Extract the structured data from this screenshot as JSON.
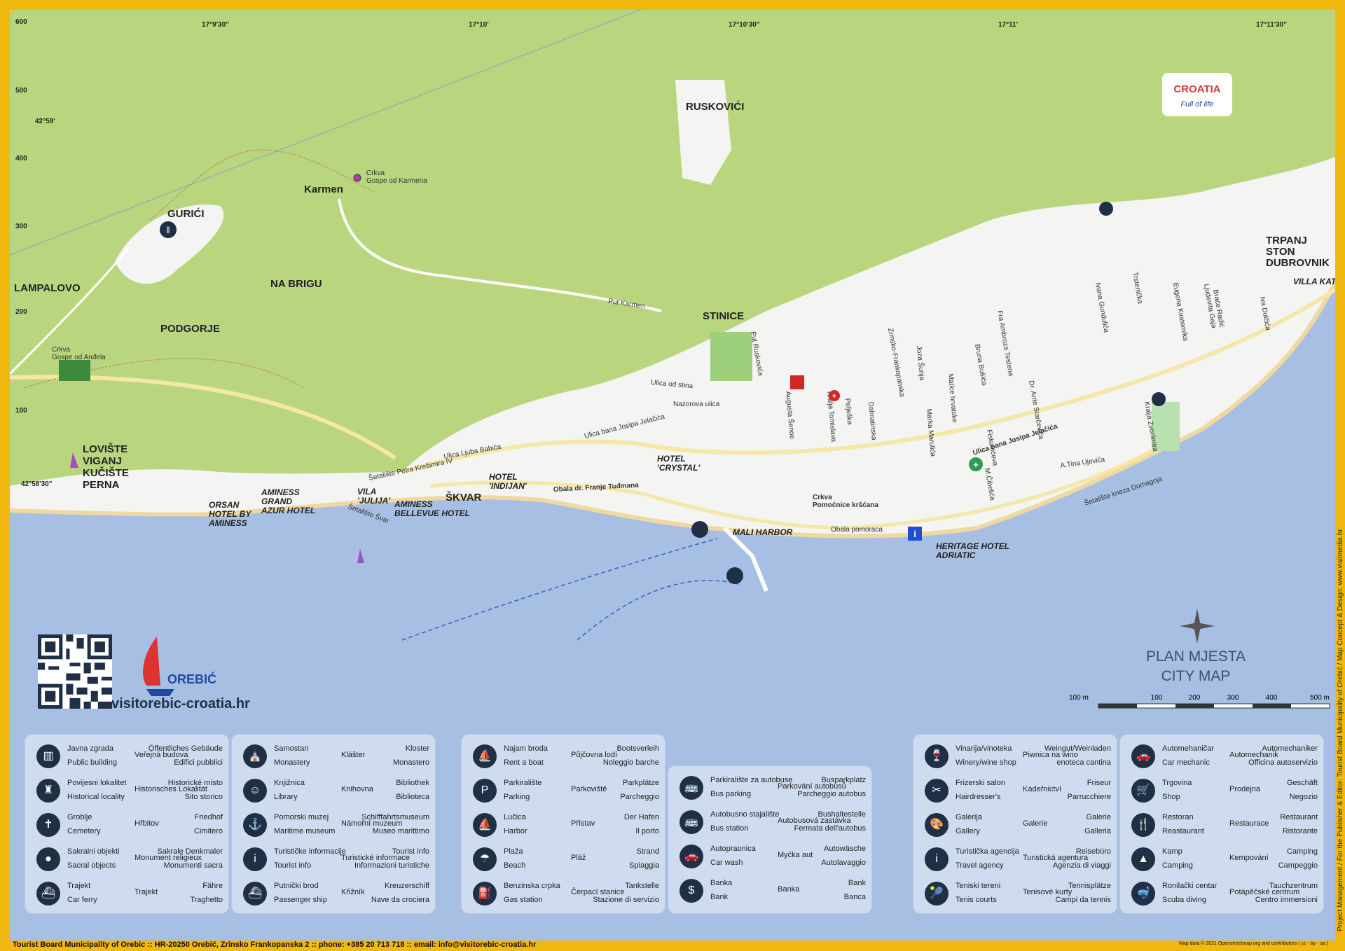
{
  "coords": {
    "elevation": [
      "600",
      "500",
      "400",
      "300",
      "200",
      "100"
    ],
    "lon": [
      "17°9'30\"",
      "17°10'",
      "17°10'30\"",
      "17°11'",
      "17°11'30\""
    ],
    "lat": [
      "42°59'",
      "42°58'30\""
    ]
  },
  "places": {
    "lampalovo": "LAMPALOVO",
    "gurici": "GURIĆI",
    "karmen": "Karmen",
    "na_brigu": "NA BRIGU",
    "podgorje": "PODGORJE",
    "ruskovici": "RUSKOVIĆI",
    "stinice": "STINICE",
    "skvar": "ŠKVAR",
    "villa_katarina": "VILLA KATARINA",
    "trpanj": "TRPANJ",
    "ston": "STON",
    "dubrovnik": "DUBROVNIK",
    "loviste": "LOVIŠTE",
    "viganj": "VIGANJ",
    "kuciste": "KUČIŠTE",
    "perna": "PERNA"
  },
  "pois": {
    "crkva_karmen_1": "Crkva",
    "crkva_karmen_2": "Gospe od Karmena",
    "crkva_andela_1": "Crkva",
    "crkva_andela_2": "Gospe od Anđela",
    "crkva_pomocnice_1": "Crkva",
    "crkva_pomocnice_2": "Pomoćnice kršćana",
    "mali_harbor": "MALI HARBOR"
  },
  "hotels": {
    "orsan_1": "ORSAN",
    "orsan_2": "HOTEL BY",
    "orsan_3": "AMINESS",
    "grand_1": "AMINESS",
    "grand_2": "GRAND",
    "grand_3": "AZUR HOTEL",
    "julija_1": "VILA",
    "julija_2": "'JULIJA'",
    "bellevue_1": "AMINESS",
    "bellevue_2": "BELLEVUE HOTEL",
    "indijan_1": "HOTEL",
    "indijan_2": "'INDIJAN'",
    "crystal_1": "HOTEL",
    "crystal_2": "'CRYSTAL'",
    "adriatic_1": "HERITAGE HOTEL",
    "adriatic_2": "ADRIATIC"
  },
  "streets": {
    "s1": "Put Karmen",
    "s2": "Ulica od stina",
    "s3": "Nazorova ulica",
    "s4": "Ulica bana Josipa Jelačića",
    "s5": "Ulica Ljuba Babića",
    "s6": "Šetalište Petra Krešimira IV",
    "s7": "Obala dr. Franje Tuđmana",
    "s8": "Šetalište Švar",
    "s9": "Ulica bana Josipa Jelačića",
    "s10": "Šetalište kneza Domagoja",
    "s11": "A.Tina Ujevića",
    "s12": "Put Ruskovića",
    "s13": "Augusta Šenoe",
    "s14": "Kralja Tomislava",
    "s15": "Pelješka",
    "s16": "Dalmatinska",
    "s17": "Zrinsko-Frankopanska",
    "s18": "Joza Šunja",
    "s19": "Marka Marulića",
    "s20": "Matice hrvatske",
    "s21": "Bruna Bušića",
    "s22": "Fra Ambroza Testena",
    "s23": "Dr. Ante Starčevića",
    "s24": "Ivana Gundulića",
    "s25": "Trstenička",
    "s26": "Eugena Kvaternika",
    "s27": "Ljudevita Gaja",
    "s28": "Braće Radić",
    "s29": "Iva Dulčića",
    "s30": "Kralja Zvonimira",
    "s31": "Fiskovićeva",
    "s32": "M.Čibelića",
    "s33": "Obala pomoraca"
  },
  "brand": {
    "croatia": "CROATIA",
    "tagline": "Full of life",
    "orebic": "OREBIĆ",
    "site": "visitorebic-croatia.hr"
  },
  "map_title": {
    "line1": "PLAN MJESTA",
    "line2": "CITY MAP"
  },
  "scale": [
    "100 m",
    "100",
    "200",
    "300",
    "400",
    "500 m"
  ],
  "legend": [
    [
      {
        "icon": "building-icon",
        "glyph": "▥",
        "hr": "Javna zgrada",
        "de": "Öffentliches Gebäude",
        "cz": "Veřejná budova",
        "en": "Public building",
        "it": "Edifici pubblici"
      },
      {
        "icon": "castle-icon",
        "glyph": "♜",
        "hr": "Povijesni lokalitet",
        "de": "Historické místo",
        "cz": "Historisches Lokalität",
        "en": "Historical locality",
        "it": "Sito storico"
      },
      {
        "icon": "cemetery-icon",
        "glyph": "✝",
        "hr": "Groblje",
        "de": "Friedhof",
        "cz": "Hřbitov",
        "en": "Cemetery",
        "it": "Cimitero"
      },
      {
        "icon": "sacral-icon",
        "glyph": "●",
        "hr": "Sakralni objekti",
        "de": "Sakrale Denkmaler",
        "cz": "Monument religieux",
        "en": "Sacral objects",
        "it": "Monumenti sacra"
      },
      {
        "icon": "ferry-icon",
        "glyph": "⛴",
        "hr": "Trajekt",
        "de": "Fähre",
        "cz": "Trajekt",
        "en": "Car ferry",
        "it": "Traghetto"
      }
    ],
    [
      {
        "icon": "monastery-icon",
        "glyph": "⛪",
        "hr": "Samostan",
        "de": "Kloster",
        "cz": "Klášter",
        "en": "Monastery",
        "it": "Monastero"
      },
      {
        "icon": "library-icon",
        "glyph": "☺",
        "hr": "Knjižnica",
        "de": "Bibliothek",
        "cz": "Knihovna",
        "en": "Library",
        "it": "Biblioteca"
      },
      {
        "icon": "museum-icon",
        "glyph": "⚓",
        "hr": "Pomorski muzej",
        "de": "Schifffahrtsmuseum",
        "cz": "Námořní muzeum",
        "en": "Maritime museum",
        "it": "Museo marittimo"
      },
      {
        "icon": "tourist-info-icon",
        "glyph": "i",
        "hr": "Turističke informacije",
        "de": "Tourist info",
        "cz": "Turistické informace",
        "en": "Tourist info",
        "it": "Informazioni turistiche"
      },
      {
        "icon": "cruise-ship-icon",
        "glyph": "⛴",
        "hr": "Putnički brod",
        "de": "Kreuzerschiff",
        "cz": "Křižník",
        "en": "Passenger ship",
        "it": "Nave da crociera"
      }
    ],
    [
      {
        "icon": "boat-rent-icon",
        "glyph": "⛵",
        "hr": "Najam broda",
        "de": "Bootsverleih",
        "cz": "Půjčovna lodí",
        "en": "Rent a boat",
        "it": "Noleggio barche"
      },
      {
        "icon": "parking-icon",
        "glyph": "P",
        "hr": "Parkiralište",
        "de": "Parkplätze",
        "cz": "Parkoviště",
        "en": "Parking",
        "it": "Parcheggio"
      },
      {
        "icon": "harbor-icon",
        "glyph": "⛵",
        "hr": "Lučica",
        "de": "Der Hafen",
        "cz": "Přístav",
        "en": "Harbor",
        "it": "Il porto"
      },
      {
        "icon": "beach-icon",
        "glyph": "☂",
        "hr": "Plaža",
        "de": "Strand",
        "cz": "Pláž",
        "en": "Beach",
        "it": "Spiaggia"
      },
      {
        "icon": "fuel-icon",
        "glyph": "⛽",
        "hr": "Benzinska crpka",
        "de": "Tankstelle",
        "cz": "Čerpací stanice",
        "en": "Gas station",
        "it": "Stazione di servizio"
      }
    ],
    [
      {
        "icon": "bus-parking-icon",
        "glyph": "🚌",
        "hr": "Parkiralište za autobuse",
        "de": "Busparkplatz",
        "cz": "Parkování autobusů",
        "en": "Bus parking",
        "it": "Parcheggio autobus"
      },
      {
        "icon": "bus-station-icon",
        "glyph": "🚌",
        "hr": "Autobusno stajalište",
        "de": "Bushaltestelle",
        "cz": "Autobusová zastávka",
        "en": "Bus station",
        "it": "Fermata dell'autobus"
      },
      {
        "icon": "car-wash-icon",
        "glyph": "🚗",
        "hr": "Autopraonica",
        "de": "Autowäsche",
        "cz": "Myčka aut",
        "en": "Car wash",
        "it": "Autolavaggio"
      },
      {
        "icon": "bank-icon",
        "glyph": "$",
        "hr": "Banka",
        "de": "Bank",
        "cz": "Banka",
        "en": "Bank",
        "it": "Banca"
      }
    ],
    [
      {
        "icon": "winery-icon",
        "glyph": "🍷",
        "hr": "Vinarija/vinoteka",
        "de": "Weingut/Weinladen",
        "cz": "Piwnica na wino",
        "en": "Winery/wine shop",
        "it": "enoteca cantina"
      },
      {
        "icon": "hairdresser-icon",
        "glyph": "✂",
        "hr": "Frizerski salon",
        "de": "Friseur",
        "cz": "Kadeřnictví",
        "en": "Hairdresser's",
        "it": "Parrucchiere"
      },
      {
        "icon": "gallery-icon",
        "glyph": "🎨",
        "hr": "Galerija",
        "de": "Galerie",
        "cz": "Galerie",
        "en": "Gallery",
        "it": "Galleria"
      },
      {
        "icon": "travel-agency-icon",
        "glyph": "i",
        "hr": "Turistička agencija",
        "de": "Reisebüro",
        "cz": "Turistická agentura",
        "en": "Travel agency",
        "it": "Agenzia di viaggi"
      },
      {
        "icon": "tennis-icon",
        "glyph": "🎾",
        "hr": "Teniski tereni",
        "de": "Tennisplätze",
        "cz": "Tenisové kurty",
        "en": "Tenis courts",
        "it": "Campi da tennis"
      }
    ],
    [
      {
        "icon": "mechanic-icon",
        "glyph": "🚗",
        "hr": "Automehaničar",
        "de": "Automechaniker",
        "cz": "Automechanik",
        "en": "Car mechanic",
        "it": "Officina autoservizio"
      },
      {
        "icon": "shop-icon",
        "glyph": "🛒",
        "hr": "Trgovina",
        "de": "Geschäft",
        "cz": "Prodejna",
        "en": "Shop",
        "it": "Negozio"
      },
      {
        "icon": "restaurant-icon",
        "glyph": "🍴",
        "hr": "Restoran",
        "de": "Restaurant",
        "cz": "Restaurace",
        "en": "Reastaurant",
        "it": "Ristorante"
      },
      {
        "icon": "camping-icon",
        "glyph": "▲",
        "hr": "Kamp",
        "de": "Camping",
        "cz": "Kempování",
        "en": "Camping",
        "it": "Campeggio"
      },
      {
        "icon": "diving-icon",
        "glyph": "🤿",
        "hr": "Ronilački centar",
        "de": "Tauchzentrum",
        "cz": "Potápěčské centrum",
        "en": "Scuba diving",
        "it": "Centro immersioni"
      }
    ]
  ],
  "footer": {
    "text": "Tourist Board Municipality of Orebic :: HR-20250 Orebić, Zrinsko Frankopanska 2 :: phone: +385 20 713 718 :: email: info@visitorebic-croatia.hr",
    "credit": "Map data © 2021 Openstreetmap.org and contributors ( cc - by - sa )",
    "side": "Project Management / For the Publisher & Editor: Tourist Board Municipality of Orebić / Map Concept & Design: www.visitmedia.hr"
  },
  "colors": {
    "frame": "#f1b90f",
    "sea": "#a7bfe3",
    "land": "#b9d67e",
    "town": "#f4f4f4",
    "legend_bg": "#cfdcf0",
    "icon_bg": "#1f2f45"
  }
}
